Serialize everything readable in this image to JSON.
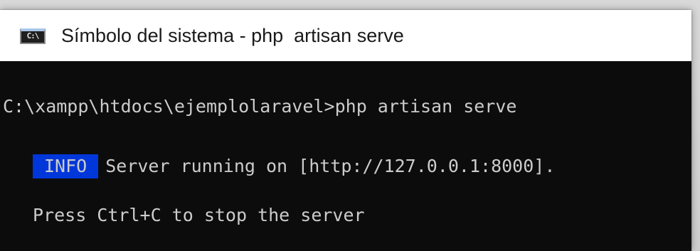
{
  "window": {
    "title": "Símbolo del sistema - php  artisan serve",
    "icon": "cmd-icon",
    "icon_text": "C:\\"
  },
  "console": {
    "prompt_line": "C:\\xampp\\htdocs\\ejemplolaravel>php artisan serve",
    "info_badge": "INFO",
    "info_message": "Server running on [http://127.0.0.1:8000].",
    "hint_line": "Press Ctrl+C to stop the server"
  },
  "colors": {
    "console_background": "#0c0c0c",
    "console_text": "#cccccc",
    "info_badge_background": "#0037da"
  }
}
